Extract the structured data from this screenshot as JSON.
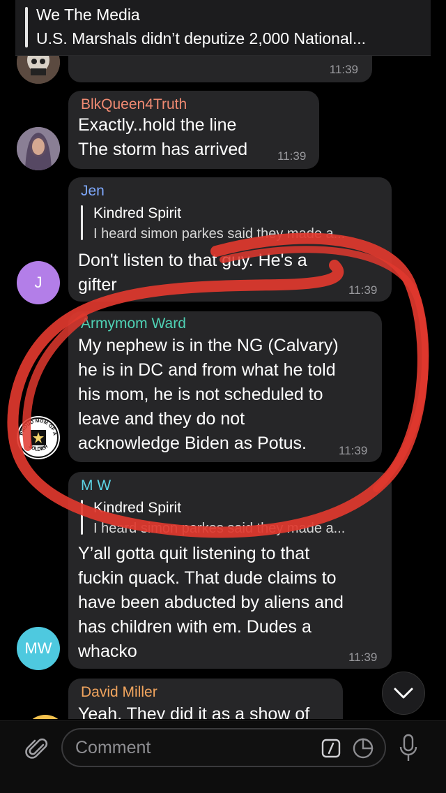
{
  "pinned": {
    "title": "We The Media",
    "text": "U.S. Marshals didn’t deputize 2,000 National..."
  },
  "messages": [
    {
      "time": "11:39",
      "avatar": {
        "kind": "image",
        "icon": "skull-mask-avatar"
      }
    },
    {
      "name": "BlkQueen4Truth",
      "name_color": "#f08a72",
      "lines": [
        "Exactly..hold the line",
        "The storm has arrived"
      ],
      "time": "11:39"
    },
    {
      "name": "Jen",
      "name_color": "#7fa9ff",
      "reply": {
        "name": "Kindred Spirit",
        "text": "I heard simon parkes said they made a..."
      },
      "lines": [
        "Don't listen to that guy. He's a",
        "gifter"
      ],
      "time": "11:39",
      "avatar": {
        "letter": "J",
        "color": "#b37ee8"
      }
    },
    {
      "name": "Armymom Ward",
      "name_color": "#4fd1b4",
      "lines": [
        "My nephew is in the NG (Calvary)",
        "he is in DC and from what he told",
        "his mom, he is not scheduled to",
        "leave and they do not",
        "acknowledge Biden as Potus."
      ],
      "time": "11:39",
      "avatar": {
        "kind": "badge",
        "top_text": "PROUD MOM OF A",
        "bottom_text": "SOLDIER",
        "center_text": "U.S. ARMY"
      }
    },
    {
      "name": "M W",
      "name_color": "#5dd4e6",
      "reply": {
        "name": "Kindred Spirit",
        "text": "I heard simon parkes said they made a..."
      },
      "lines": [
        "Y’all gotta quit listening to that",
        "fuckin quack. That dude claims to",
        "have been abducted by aliens and",
        "has children with em. Dudes a",
        "whacko"
      ],
      "time": "11:39",
      "avatar": {
        "letter": "MW",
        "color": "#4ec9df"
      }
    },
    {
      "name": "David Miller",
      "name_color": "#f2a55e",
      "lines": [
        "Yeah. They did it as a show of"
      ]
    }
  ],
  "input": {
    "placeholder": "Comment"
  },
  "colors": {
    "annotation": "#e0382e",
    "bubble": "#262628"
  }
}
